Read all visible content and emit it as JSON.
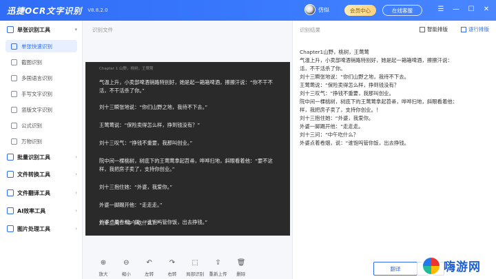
{
  "app": {
    "title": "迅捷OCR文字识别",
    "version": "V8.8.2.0",
    "user_name": "仿似",
    "vip_label": "会员中心",
    "service_label": "在线客服",
    "win_controls": [
      "☰",
      "—",
      "☐",
      "✕"
    ]
  },
  "sidebar": {
    "groups": [
      {
        "label": "单张识别工具",
        "icon": "single-scan-icon",
        "expanded": true
      },
      {
        "label": "批量识别工具",
        "icon": "batch-icon",
        "expanded": false
      },
      {
        "label": "文件转换工具",
        "icon": "convert-icon",
        "expanded": false
      },
      {
        "label": "文件翻译工具",
        "icon": "translate-icon",
        "expanded": false
      },
      {
        "label": "AI效率工具",
        "icon": "ai-icon",
        "expanded": false
      },
      {
        "label": "图片处理工具",
        "icon": "image-icon",
        "expanded": false
      }
    ],
    "items": [
      {
        "label": "单张快速识别",
        "active": true
      },
      {
        "label": "截图识别",
        "active": false
      },
      {
        "label": "多国语言识别",
        "active": false
      },
      {
        "label": "手写文字识别",
        "active": false
      },
      {
        "label": "竖版文字识别",
        "active": false
      },
      {
        "label": "公式识别",
        "active": false
      },
      {
        "label": "万物识别",
        "active": false
      }
    ]
  },
  "left_panel": {
    "label": "识别文件",
    "doc_header": "Chapter 1 山野，桃树，王莺莺",
    "doc_lines": [
      "气温上升，小卖部啤酒销路特别好，她是起一箱箱啤酒，擦擦汗说：“你不干不",
      "活，不干活杀了你。”",
      "刘十三瞬张地说：“你们山野之地，我待不下去。”",
      "王莺莺说：“保险卖得怎么样，挣到钱没有？”",
      "刘十三叹气：“挣钱不重要，我那叫创业。”",
      "院中间一棵桃树，树底下的王莺莺拿起苕帚，哗哗扫地，斜眼看着他：“要不这",
      "样，我把房子卖了，支持你创业。”",
      "刘十三抱住她：“外婆，我爱你。”",
      "外婆一脚踢开他：“走走走。”",
      "刘十三问：“中午吃什么？”",
      "外婆点着卷烟，说：“谁饱吗管你饭，出去挣钱。”"
    ],
    "tools": [
      {
        "label": "放大",
        "icon": "zoom-in-icon",
        "glyph": "⊕"
      },
      {
        "label": "缩小",
        "icon": "zoom-out-icon",
        "glyph": "⊖"
      },
      {
        "label": "左转",
        "icon": "rotate-left-icon",
        "glyph": "↶"
      },
      {
        "label": "右转",
        "icon": "rotate-right-icon",
        "glyph": "↷"
      },
      {
        "label": "局部识别",
        "icon": "crop-icon",
        "glyph": "⬚"
      },
      {
        "label": "重新上传",
        "icon": "upload-icon",
        "glyph": "⇪"
      },
      {
        "label": "删除",
        "icon": "delete-icon",
        "glyph": "🗑"
      }
    ]
  },
  "right_panel": {
    "label": "识别结果",
    "smart_layout": "智能排版",
    "line_layout": "逐行排版",
    "result_lines": [
      "Chapter1山野，桃树，王莺莺",
      "气温上升，小卖部啤酒销路特别好，她是起一箱箱啤酒，擦擦汗说：",
      "活，不干活杀了你。",
      "刘十三瞬张地说：“你们山野之地，我待不下去。",
      "王莺莺说：“保险卖得怎么样，挣到钱没有？",
      "刘十三叹气：“挣钱不重要，我那叫创业。",
      "院中间一棵桃树，树底下的王莺莺拿起苕帚，哗哗扫地，斜眼看着他：",
      "样，我把房子卖了，支持你创业。！",
      "刘十三抱住她：“外婆，我爱你。",
      "外婆一脚踢开他：“走走走。",
      "刘十三问：“中午吃什么？",
      "外婆点着卷烟，说：“谁饱吗管你饭，出去挣钱。"
    ],
    "translate_label": "翻译"
  },
  "watermark": {
    "text": "嗨游网"
  }
}
